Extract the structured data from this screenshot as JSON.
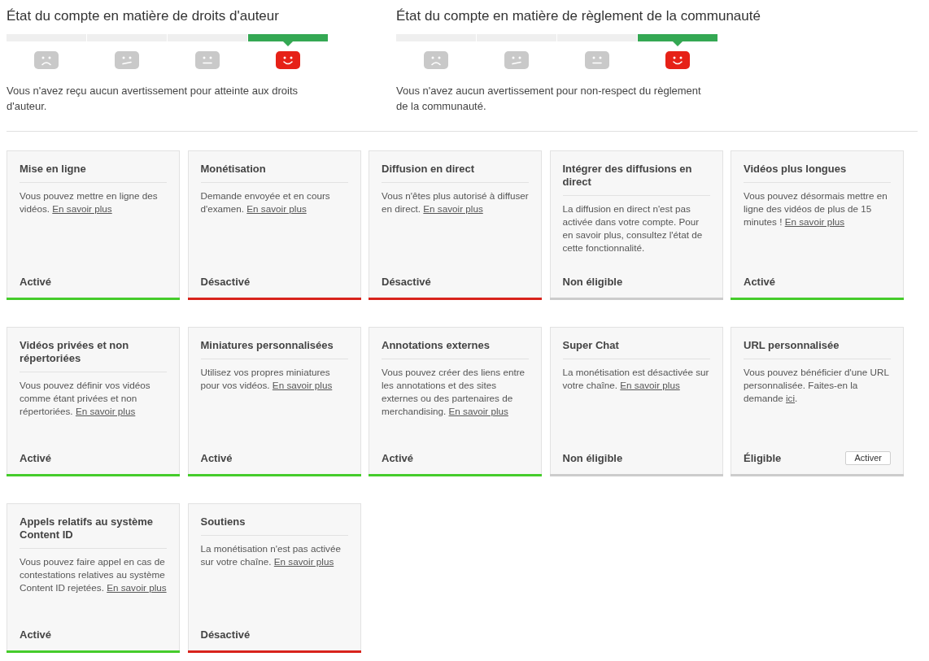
{
  "account_status": [
    {
      "title": "État du compte en matière de droits d'auteur",
      "segments": [
        {
          "kind": "sad",
          "selected": false
        },
        {
          "kind": "unsure",
          "selected": false
        },
        {
          "kind": "neutral",
          "selected": false
        },
        {
          "kind": "happy",
          "selected": true
        }
      ],
      "message": "Vous n'avez reçu aucun avertissement pour atteinte aux droits d'auteur."
    },
    {
      "title": "État du compte en matière de règlement de la communauté",
      "segments": [
        {
          "kind": "sad",
          "selected": false
        },
        {
          "kind": "unsure",
          "selected": false
        },
        {
          "kind": "neutral",
          "selected": false
        },
        {
          "kind": "happy",
          "selected": true
        }
      ],
      "message": "Vous n'avez aucun avertissement pour non-respect du règlement de la communauté."
    }
  ],
  "features": [
    {
      "title": "Mise en ligne",
      "description": "Vous pouvez mettre en ligne des vidéos.",
      "link": "En savoir plus",
      "status": "Activé",
      "kind": "enabled"
    },
    {
      "title": "Monétisation",
      "description": "Demande envoyée et en cours d'examen.",
      "link": "En savoir plus",
      "status": "Désactivé",
      "kind": "disabled"
    },
    {
      "title": "Diffusion en direct",
      "description": "Vous n'êtes plus autorisé à diffuser en direct.",
      "link": "En savoir plus",
      "status": "Désactivé",
      "kind": "disabled"
    },
    {
      "title": "Intégrer des diffusions en direct",
      "description": "La diffusion en direct n'est pas activée dans votre compte. Pour en savoir plus, consultez l'état de cette fonctionnalité.",
      "status": "Non éligible",
      "kind": "ineligible"
    },
    {
      "title": "Vidéos plus longues",
      "description": "Vous pouvez désormais mettre en ligne des vidéos de plus de 15 minutes !",
      "link": "En savoir plus",
      "status": "Activé",
      "kind": "enabled"
    },
    {
      "title": "Vidéos privées et non répertoriées",
      "description": "Vous pouvez définir vos vidéos comme étant privées et non répertoriées.",
      "link": "En savoir plus",
      "status": "Activé",
      "kind": "enabled"
    },
    {
      "title": "Miniatures personnalisées",
      "description": "Utilisez vos propres miniatures pour vos vidéos.",
      "link": "En savoir plus",
      "status": "Activé",
      "kind": "enabled"
    },
    {
      "title": "Annotations externes",
      "description": "Vous pouvez créer des liens entre les annotations et des sites externes ou des partenaires de merchandising.",
      "link": "En savoir plus",
      "status": "Activé",
      "kind": "enabled"
    },
    {
      "title": "Super Chat",
      "description": "La monétisation est désactivée sur votre chaîne.",
      "link": "En savoir plus",
      "status": "Non éligible",
      "kind": "ineligible"
    },
    {
      "title": "URL personnalisée",
      "description": "Vous pouvez bénéficier d'une URL personnalisée. Faites-en la demande",
      "link": "ici",
      "description_end": ".",
      "status": "Éligible",
      "kind": "eligible",
      "button": "Activer"
    },
    {
      "title": "Appels relatifs au système Content ID",
      "description": "Vous pouvez faire appel en cas de contestations relatives au système Content ID rejetées.",
      "link": "En savoir plus",
      "status": "Activé",
      "kind": "enabled"
    },
    {
      "title": "Soutiens",
      "description": "La monétisation n'est pas activée sur votre chaîne.",
      "link": "En savoir plus",
      "status": "Désactivé",
      "kind": "disabled"
    }
  ]
}
